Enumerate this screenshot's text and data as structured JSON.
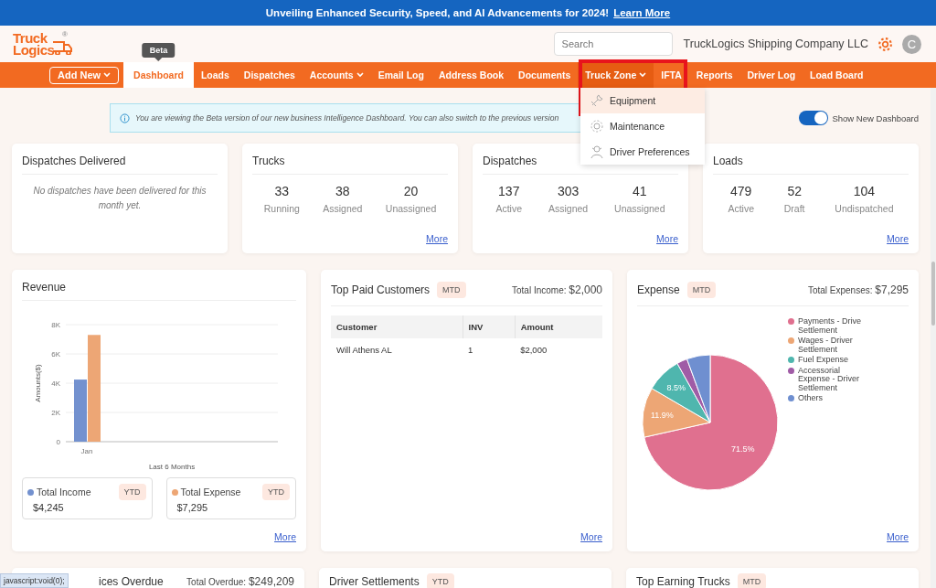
{
  "announcement": {
    "text": "Unveiling Enhanced Security, Speed, and AI Advancements for 2024!",
    "link": "Learn More"
  },
  "header": {
    "logo": {
      "line1": "Truck",
      "line2": "Logics",
      "mark": "®"
    },
    "search": {
      "placeholder": "Search"
    },
    "company": "TruckLogics Shipping Company LLC",
    "avatar": "C"
  },
  "nav": {
    "add_button": "Add New",
    "items": [
      {
        "label": "Dashboard",
        "selected": true,
        "dropdown": false,
        "expanded": false,
        "tooltip": "Beta"
      },
      {
        "label": "Loads",
        "selected": false,
        "dropdown": false,
        "expanded": false
      },
      {
        "label": "Dispatches",
        "selected": false,
        "dropdown": false,
        "expanded": false
      },
      {
        "label": "Accounts",
        "selected": false,
        "dropdown": true,
        "expanded": false
      },
      {
        "label": "Email Log",
        "selected": false,
        "dropdown": false,
        "expanded": false
      },
      {
        "label": "Address Book",
        "selected": false,
        "dropdown": false,
        "expanded": false
      },
      {
        "label": "Documents",
        "selected": false,
        "dropdown": false,
        "expanded": false
      },
      {
        "label": "Truck Zone",
        "selected": false,
        "dropdown": true,
        "expanded": true,
        "menu": [
          {
            "label": "Equipment",
            "selected": true
          },
          {
            "label": "Maintenance",
            "selected": false
          },
          {
            "label": "Driver Preferences",
            "selected": false
          }
        ]
      },
      {
        "label": "IFTA",
        "selected": false,
        "dropdown": false,
        "expanded": false
      },
      {
        "label": "Reports",
        "selected": false,
        "dropdown": false,
        "expanded": false
      },
      {
        "label": "Driver Log",
        "selected": false,
        "dropdown": false,
        "expanded": false
      },
      {
        "label": "Load Board",
        "selected": false,
        "dropdown": false,
        "expanded": false
      }
    ]
  },
  "info": {
    "text": "You are viewing the Beta version of our new business Intelligence Dashboard. You can also switch to the previous version",
    "toggle": {
      "label": "Show New Dashboard",
      "on": true
    }
  },
  "summary_cards": [
    {
      "title": "Dispatches Delivered",
      "kind": "message",
      "message": "No dispatches have been delivered for this month yet."
    },
    {
      "title": "Trucks",
      "kind": "stats",
      "stats": [
        {
          "value": "33",
          "label": "Running"
        },
        {
          "value": "38",
          "label": "Assigned"
        },
        {
          "value": "20",
          "label": "Unassigned"
        }
      ],
      "link": "More"
    },
    {
      "title": "Dispatches",
      "kind": "stats",
      "stats": [
        {
          "value": "137",
          "label": "Active"
        },
        {
          "value": "303",
          "label": "Assigned"
        },
        {
          "value": "41",
          "label": "Unassigned"
        }
      ],
      "link": "More"
    },
    {
      "title": "Loads",
      "kind": "stats",
      "stats": [
        {
          "value": "479",
          "label": "Active"
        },
        {
          "value": "52",
          "label": "Draft"
        },
        {
          "value": "104",
          "label": "Undispatched"
        }
      ],
      "link": "More"
    }
  ],
  "revenue": {
    "title": "Revenue",
    "chart_data": {
      "type": "bar",
      "grid": true,
      "ylabel": "Amounts($)",
      "xlabel": "Last 6 Months",
      "categories": [
        "Jan"
      ],
      "ylim": [
        0,
        8000
      ],
      "yticks": [
        {
          "value": 0,
          "label": "0"
        },
        {
          "value": 2000,
          "label": "2K"
        },
        {
          "value": 4000,
          "label": "4K"
        },
        {
          "value": 6000,
          "label": "6K"
        },
        {
          "value": 8000,
          "label": "8K"
        }
      ],
      "series": [
        {
          "name": "Total Income",
          "color": "#7391cf",
          "values": [
            4245
          ]
        },
        {
          "name": "Total Expense",
          "color": "#eda675",
          "values": [
            7295
          ]
        }
      ]
    },
    "totals": [
      {
        "badge": "YTD",
        "value": "$4,245"
      },
      {
        "badge": "YTD",
        "value": "$7,295"
      }
    ],
    "link": "More"
  },
  "top_paid_customers": {
    "title": "Top Paid Customers",
    "badge": "MTD",
    "total_label": "Total Income:",
    "total": "$2,000",
    "columns": [
      "Customer",
      "INV",
      "Amount"
    ],
    "rows": [
      [
        "Will Athens AL",
        "1",
        "$2,000"
      ]
    ],
    "link": "More"
  },
  "expense": {
    "title": "Expense",
    "badge": "MTD",
    "total_label": "Total Expenses:",
    "total": "$7,295",
    "chart_data": {
      "type": "pie",
      "categories": [
        "Payments - Drive Settlement",
        "Wages - Driver Settlement",
        "Fuel Expense",
        "Accessorial Expense - Driver Settlement",
        "Others"
      ],
      "colors": [
        "#e0708f",
        "#eda675",
        "#4fb6ae",
        "#a05ca6",
        "#6f8fd0"
      ],
      "series": [
        {
          "values": [
            71.5,
            11.9,
            8.5,
            2.5,
            5.6
          ]
        }
      ],
      "value_labels": [
        "71.5%",
        "11.9%",
        "8.5%",
        null,
        null
      ],
      "legend": true
    },
    "link": "More"
  },
  "bottom_cards": [
    {
      "title": "ices Overdue",
      "total_label": "Total Overdue:",
      "total": "$249,209"
    },
    {
      "title": "Driver Settlements",
      "badge": "YTD"
    },
    {
      "title": "Top Earning Trucks",
      "badge": "MTD"
    }
  ],
  "status_url": "javascript:void(0);"
}
